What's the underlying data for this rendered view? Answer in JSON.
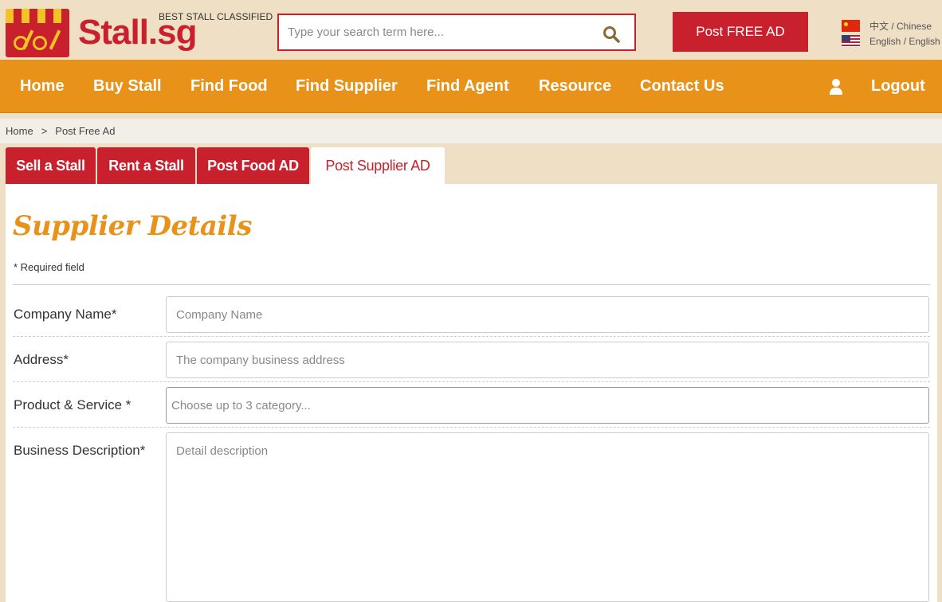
{
  "header": {
    "logo_text": "Stall.sg",
    "tagline": "BEST STALL CLASSIFIED",
    "search_placeholder": "Type your search term here...",
    "post_ad_label": "Post FREE AD",
    "languages": [
      {
        "label": "中文 / Chinese"
      },
      {
        "label": "English / English"
      }
    ]
  },
  "nav": {
    "items": [
      {
        "label": "Home"
      },
      {
        "label": "Buy Stall"
      },
      {
        "label": "Find Food"
      },
      {
        "label": "Find Supplier"
      },
      {
        "label": "Find Agent"
      },
      {
        "label": "Resource"
      },
      {
        "label": "Contact Us"
      }
    ],
    "logout_label": "Logout"
  },
  "breadcrumb": {
    "home": "Home",
    "separator": ">",
    "current": "Post Free Ad"
  },
  "tabs": [
    {
      "label": "Sell a Stall"
    },
    {
      "label": "Rent a Stall"
    },
    {
      "label": "Post Food AD"
    },
    {
      "label": "Post Supplier AD"
    }
  ],
  "form": {
    "title": "Supplier Details",
    "required_note": "* Required field",
    "company_name": {
      "label": "Company Name*",
      "placeholder": "Company Name"
    },
    "address": {
      "label": "Address*",
      "placeholder": "The company business address"
    },
    "product_service": {
      "label": "Product & Service *",
      "placeholder": "Choose up to 3 category..."
    },
    "description": {
      "label": "Business Description*",
      "placeholder": "Detail description"
    }
  },
  "colors": {
    "brand_red": "#c8202c",
    "nav_orange": "#e8921a",
    "page_bg": "#efdfc4"
  }
}
